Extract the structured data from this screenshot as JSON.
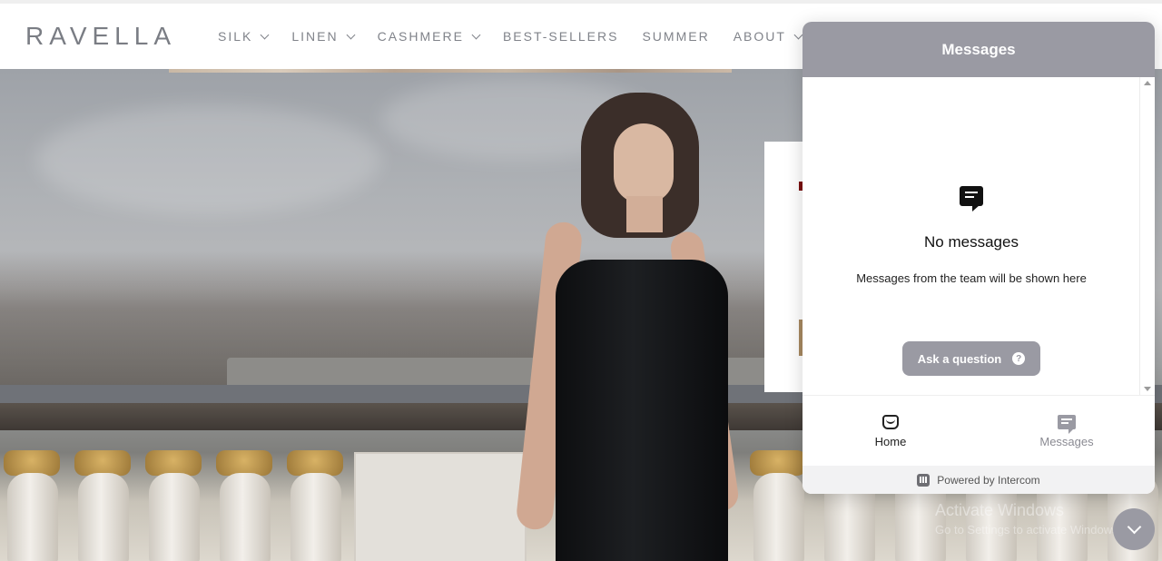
{
  "header": {
    "logo": "RAVELLA",
    "nav": [
      {
        "label": "SILK",
        "has_dropdown": true
      },
      {
        "label": "LINEN",
        "has_dropdown": true
      },
      {
        "label": "CASHMERE",
        "has_dropdown": true
      },
      {
        "label": "BEST-SELLERS",
        "has_dropdown": false
      },
      {
        "label": "SUMMER",
        "has_dropdown": false
      },
      {
        "label": "ABOUT",
        "has_dropdown": true
      }
    ]
  },
  "chat": {
    "title": "Messages",
    "empty_title": "No messages",
    "empty_subtitle": "Messages from the team will be shown here",
    "ask_button": "Ask a question",
    "tabs": [
      {
        "label": "Home",
        "icon": "home-icon"
      },
      {
        "label": "Messages",
        "icon": "messages-icon"
      }
    ],
    "powered_by": "Powered by Intercom",
    "accent_color": "#9a9aa3"
  },
  "watermark": {
    "line1": "Activate Windows",
    "line2": "Go to Settings to activate Windows."
  }
}
